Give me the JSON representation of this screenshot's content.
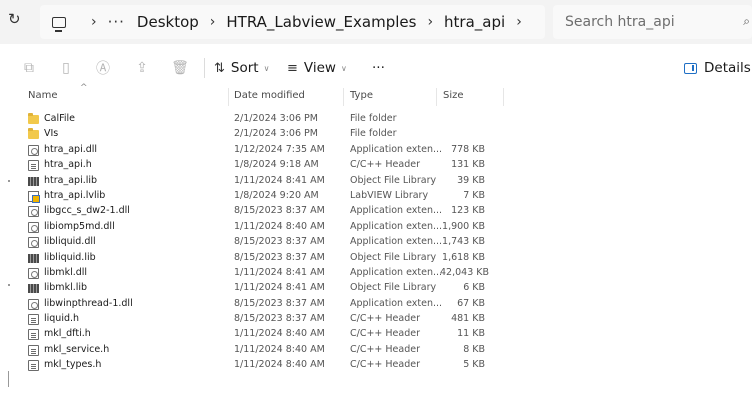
{
  "address_bar": {
    "overflow": "···",
    "crumbs": [
      "Desktop",
      "HTRA_Labview_Examples",
      "htra_api"
    ],
    "separator": "›"
  },
  "search": {
    "placeholder": "Search htra_api"
  },
  "toolbar": {
    "sort_label": "Sort",
    "view_label": "View",
    "more_label": "···",
    "details_label": "Details"
  },
  "columns": {
    "name": "Name",
    "date": "Date modified",
    "type": "Type",
    "size": "Size"
  },
  "files": [
    {
      "icon": "folder-icon",
      "name": "CalFile",
      "date": "2/1/2024 3:06 PM",
      "type": "File folder",
      "size": ""
    },
    {
      "icon": "folder-icon",
      "name": "VIs",
      "date": "2/1/2024 3:06 PM",
      "type": "File folder",
      "size": ""
    },
    {
      "icon": "dll-file-icon",
      "name": "htra_api.dll",
      "date": "1/12/2024 7:35 AM",
      "type": "Application exten...",
      "size": "778 KB"
    },
    {
      "icon": "header-file-icon",
      "name": "htra_api.h",
      "date": "1/8/2024 9:18 AM",
      "type": "C/C++ Header",
      "size": "131 KB"
    },
    {
      "icon": "lib-file-icon",
      "name": "htra_api.lib",
      "date": "1/11/2024 8:41 AM",
      "type": "Object File Library",
      "size": "39 KB"
    },
    {
      "icon": "labview-library-icon",
      "name": "htra_api.lvlib",
      "date": "1/8/2024 9:20 AM",
      "type": "LabVIEW Library",
      "size": "7 KB"
    },
    {
      "icon": "dll-file-icon",
      "name": "libgcc_s_dw2-1.dll",
      "date": "8/15/2023 8:37 AM",
      "type": "Application exten...",
      "size": "123 KB"
    },
    {
      "icon": "dll-file-icon",
      "name": "libiomp5md.dll",
      "date": "1/11/2024 8:40 AM",
      "type": "Application exten...",
      "size": "1,900 KB"
    },
    {
      "icon": "dll-file-icon",
      "name": "libliquid.dll",
      "date": "8/15/2023 8:37 AM",
      "type": "Application exten...",
      "size": "1,743 KB"
    },
    {
      "icon": "lib-file-icon",
      "name": "libliquid.lib",
      "date": "8/15/2023 8:37 AM",
      "type": "Object File Library",
      "size": "1,618 KB"
    },
    {
      "icon": "dll-file-icon",
      "name": "libmkl.dll",
      "date": "1/11/2024 8:41 AM",
      "type": "Application exten...",
      "size": "42,043 KB"
    },
    {
      "icon": "lib-file-icon",
      "name": "libmkl.lib",
      "date": "1/11/2024 8:41 AM",
      "type": "Object File Library",
      "size": "6 KB"
    },
    {
      "icon": "dll-file-icon",
      "name": "libwinpthread-1.dll",
      "date": "8/15/2023 8:37 AM",
      "type": "Application exten...",
      "size": "67 KB"
    },
    {
      "icon": "header-file-icon",
      "name": "liquid.h",
      "date": "8/15/2023 8:37 AM",
      "type": "C/C++ Header",
      "size": "481 KB"
    },
    {
      "icon": "header-file-icon",
      "name": "mkl_dfti.h",
      "date": "1/11/2024 8:40 AM",
      "type": "C/C++ Header",
      "size": "11 KB"
    },
    {
      "icon": "header-file-icon",
      "name": "mkl_service.h",
      "date": "1/11/2024 8:40 AM",
      "type": "C/C++ Header",
      "size": "8 KB"
    },
    {
      "icon": "header-file-icon",
      "name": "mkl_types.h",
      "date": "1/11/2024 8:40 AM",
      "type": "C/C++ Header",
      "size": "5 KB"
    }
  ]
}
